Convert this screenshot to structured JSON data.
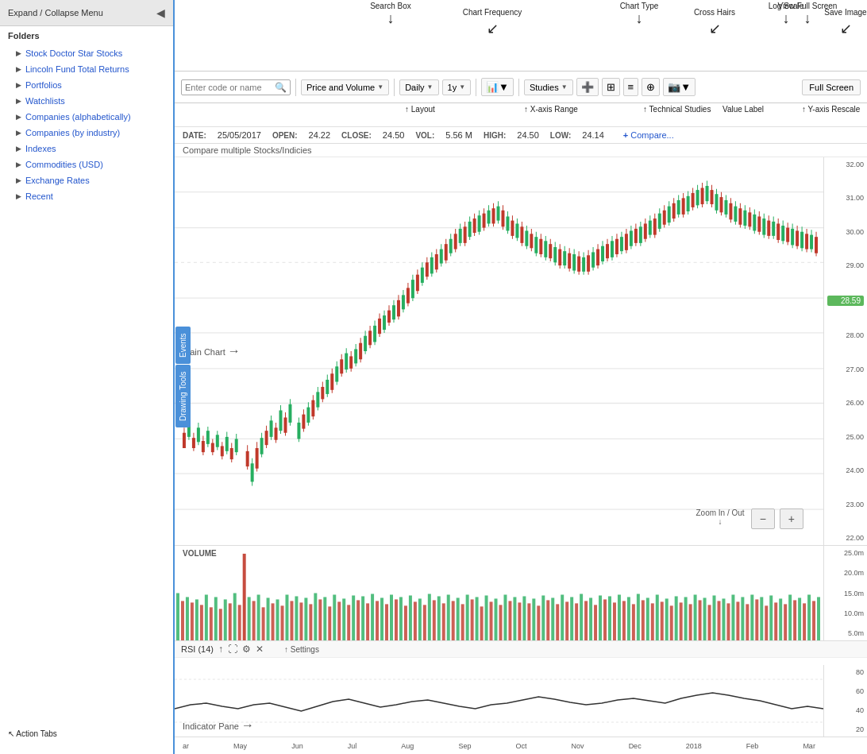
{
  "sidebar": {
    "header_label": "Expand / Collapse Menu",
    "folders_label": "Folders",
    "items": [
      {
        "label": "Stock Doctor Star Stocks"
      },
      {
        "label": "Lincoln Fund Total Returns"
      },
      {
        "label": "Portfolios"
      },
      {
        "label": "Watchlists"
      },
      {
        "label": "Companies (alphabetically)"
      },
      {
        "label": "Companies (by industry)"
      },
      {
        "label": "Indexes"
      },
      {
        "label": "Commodities (USD)"
      },
      {
        "label": "Exchange Rates"
      },
      {
        "label": "Recent"
      }
    ],
    "action_tabs": [
      "Events",
      "Drawing Tools"
    ]
  },
  "toolbar": {
    "search_placeholder": "Enter code or name",
    "layout_label": "Price and Volume",
    "frequency_label": "Daily",
    "range_label": "1y",
    "chart_type_icon": "📈",
    "studies_label": "Studies",
    "fullscreen_label": "Full Screen"
  },
  "chart_info": {
    "date_label": "DATE:",
    "date_value": "25/05/2017",
    "open_label": "OPEN:",
    "open_value": "24.22",
    "close_label": "CLOSE:",
    "close_value": "24.50",
    "vol_label": "VOL:",
    "vol_value": "5.56 M",
    "high_label": "HIGH:",
    "high_value": "24.50",
    "low_label": "LOW:",
    "low_value": "24.14",
    "compare_label": "Compare..."
  },
  "chart": {
    "current_price": "28.59",
    "y_labels": [
      "32.00",
      "31.00",
      "30.00",
      "29.00",
      "28.00",
      "27.00",
      "26.00",
      "25.00",
      "24.00",
      "23.00",
      "22.00"
    ],
    "volume_y_labels": [
      "25.0m",
      "20.0m",
      "15.0m",
      "10.0m",
      "5.0m"
    ],
    "rsi_title": "RSI (14)",
    "rsi_y_labels": [
      "80",
      "60",
      "40",
      "20"
    ],
    "x_labels": [
      "ar",
      "May",
      "Jun",
      "Jul",
      "Aug",
      "Sep",
      "Oct",
      "Nov",
      "Dec",
      "2018",
      "Feb",
      "Mar"
    ]
  },
  "annotations": {
    "search_box": "Search Box",
    "chart_frequency": "Chart Frequency",
    "chart_type": "Chart Type",
    "cross_hairs": "Cross Hairs",
    "log_scale": "Log Scale",
    "save_image": "Save Image",
    "view_full_screen": "View Full Screen",
    "layout": "Layout",
    "x_axis_range": "X-axis Range",
    "technical_studies": "Technical Studies",
    "value_label": "Value Label",
    "y_axis_rescale": "Y-axis Rescale",
    "compare_stocks": "Compare multiple Stocks/Indicies",
    "main_chart": "Main Chart",
    "zoom_in_out": "Zoom In / Out",
    "settings": "Settings",
    "indicator_pane": "Indicator Pane",
    "action_tabs": "Action Tabs"
  },
  "zoom": {
    "minus": "−",
    "plus": "+"
  }
}
